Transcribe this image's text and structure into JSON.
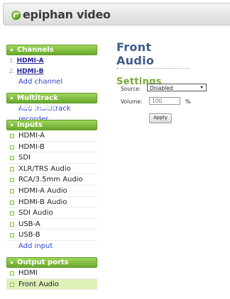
{
  "brand": {
    "name": "epiphan video"
  },
  "sidebar": {
    "channels": {
      "title": "Channels",
      "items": [
        {
          "num": "1.",
          "label": "HDMI-A"
        },
        {
          "num": "2.",
          "label": "HDMI-B"
        }
      ],
      "add_label": "Add channel"
    },
    "multitrack": {
      "title": "Multitrack recorders",
      "add_label": "Add multitrack recorder"
    },
    "inputs": {
      "title": "Inputs",
      "items": [
        "HDMI-A",
        "HDMI-B",
        "SDI",
        "XLR/TRS Audio",
        "RCA/3.5mm Audio",
        "HDMI-A Audio",
        "HDMI-B Audio",
        "SDI Audio",
        "USB-A",
        "USB-B"
      ],
      "add_label": "Add input"
    },
    "outputs": {
      "title": "Output ports",
      "items": [
        "HDMI",
        "Front Audio"
      ],
      "selected": "Front Audio"
    }
  },
  "main": {
    "title": "Front Audio",
    "subtitle": "Settings",
    "source_label": "Source:",
    "source_value": "Disabled",
    "volume_label": "Volume:",
    "volume_value": "100",
    "volume_unit": "%",
    "apply_label": "Apply"
  },
  "colors": {
    "accent_green": "#7cbf3a",
    "title_blue": "#3f5c86",
    "link_blue": "#3344cc"
  }
}
